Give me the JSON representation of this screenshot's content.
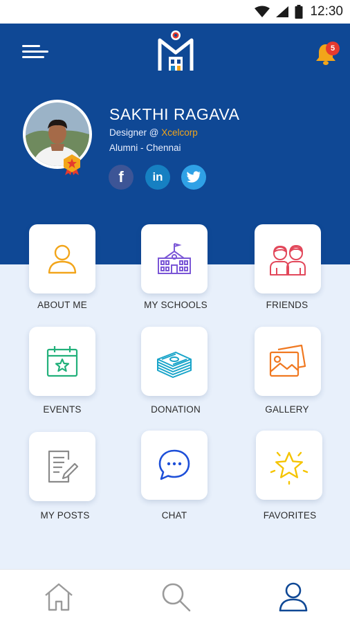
{
  "status_bar": {
    "time": "12:30",
    "icons": [
      "wifi-icon",
      "signal-icon",
      "battery-icon"
    ]
  },
  "header": {
    "menu_icon": "menu-icon",
    "logo_icon": "school-logo-icon",
    "notification_icon": "bell-icon",
    "notification_count": "5"
  },
  "profile": {
    "name": "SAKTHI RAGAVA",
    "role_prefix": "Designer @ ",
    "company": "Xcelcorp",
    "alumni": "Alumni - Chennai",
    "badge_icon": "star-rank-badge-icon",
    "social": [
      {
        "name": "facebook",
        "glyph": "f",
        "icon": "facebook-icon"
      },
      {
        "name": "linkedin",
        "glyph": "in",
        "icon": "linkedin-icon"
      },
      {
        "name": "twitter",
        "glyph": "",
        "icon": "twitter-icon"
      }
    ]
  },
  "menu": {
    "items": [
      {
        "label": "ABOUT ME",
        "icon": "person-icon"
      },
      {
        "label": "MY SCHOOLS",
        "icon": "school-building-icon"
      },
      {
        "label": "FRIENDS",
        "icon": "friends-icon"
      },
      {
        "label": "EVENTS",
        "icon": "calendar-star-icon"
      },
      {
        "label": "DONATION",
        "icon": "money-stack-icon"
      },
      {
        "label": "GALLERY",
        "icon": "photos-icon"
      },
      {
        "label": "MY POSTS",
        "icon": "post-edit-icon"
      },
      {
        "label": "CHAT",
        "icon": "chat-bubble-icon"
      },
      {
        "label": "FAVORITES",
        "icon": "star-icon"
      }
    ]
  },
  "bottom_nav": {
    "items": [
      {
        "name": "home",
        "icon": "home-icon"
      },
      {
        "name": "search",
        "icon": "search-icon"
      },
      {
        "name": "profile",
        "icon": "profile-icon",
        "active": true
      }
    ]
  },
  "colors": {
    "header_blue": "#0f4895",
    "page_background": "#e8f0fb",
    "accent_orange": "#f2a51a",
    "badge_red": "#e63a2e",
    "nav_active": "#0f4895",
    "nav_inactive": "#9a9a9a"
  }
}
